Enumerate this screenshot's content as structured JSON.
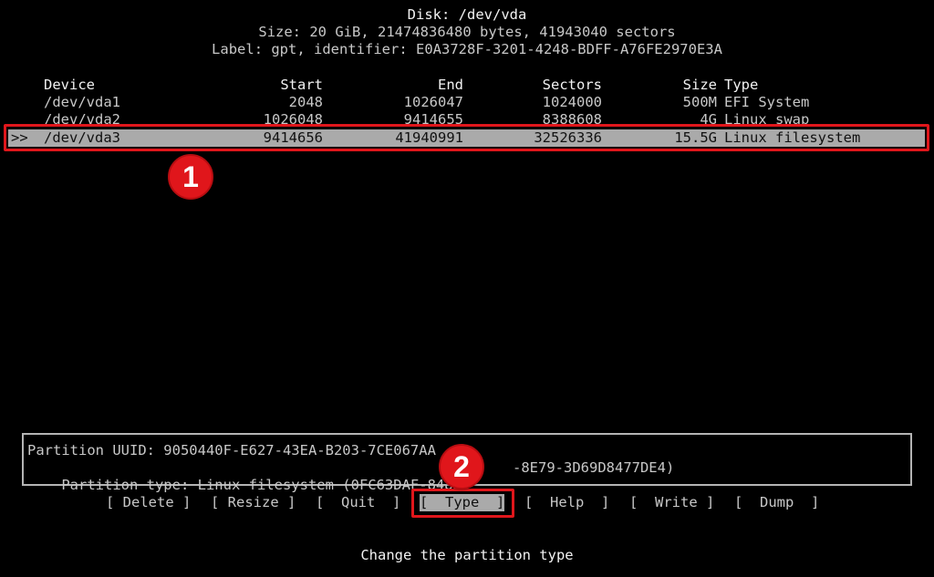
{
  "header": {
    "disk_line": "Disk: /dev/vda",
    "size_line": "Size: 20 GiB, 21474836480 bytes, 41943040 sectors",
    "label_line": "Label: gpt, identifier: E0A3728F-3201-4248-BDFF-A76FE2970E3A"
  },
  "table": {
    "columns": [
      "Device",
      "Start",
      "End",
      "Sectors",
      "Size",
      "Type"
    ],
    "selected_marker": ">>",
    "rows": [
      {
        "device": "/dev/vda1",
        "start": "2048",
        "end": "1026047",
        "sectors": "1024000",
        "size": "500M",
        "type": "EFI System",
        "selected": false
      },
      {
        "device": "/dev/vda2",
        "start": "1026048",
        "end": "9414655",
        "sectors": "8388608",
        "size": "4G",
        "type": "Linux swap",
        "selected": false
      },
      {
        "device": "/dev/vda3",
        "start": "9414656",
        "end": "41940991",
        "sectors": "32526336",
        "size": "15.5G",
        "type": "Linux filesystem",
        "selected": true
      }
    ]
  },
  "info": {
    "uuid_line": "Partition UUID: 9050440F-E627-43EA-B203-7CE067AA",
    "type_line": "Partition type: Linux filesystem (0FC63DAF-8483-",
    "type_line_tail": "-8E79-3D69D8477DE4)"
  },
  "menu": {
    "items": [
      {
        "label": "[ Delete ]",
        "active": false
      },
      {
        "label": "[ Resize ]",
        "active": false
      },
      {
        "label": "[  Quit  ]",
        "active": false
      },
      {
        "label": "[  Type  ]",
        "active": true
      },
      {
        "label": "[  Help  ]",
        "active": false
      },
      {
        "label": "[  Write ]",
        "active": false
      },
      {
        "label": "[  Dump  ]",
        "active": false
      }
    ]
  },
  "status_text": "Change the partition type",
  "annotations": {
    "badge_1": "1",
    "badge_2": "2",
    "color": "#e0161b"
  },
  "colors": {
    "background": "#000000",
    "text": "#c8c8c8",
    "highlight_bg": "#aaaaaa",
    "highlight_text": "#111111",
    "annotation_red": "#e0161b"
  }
}
